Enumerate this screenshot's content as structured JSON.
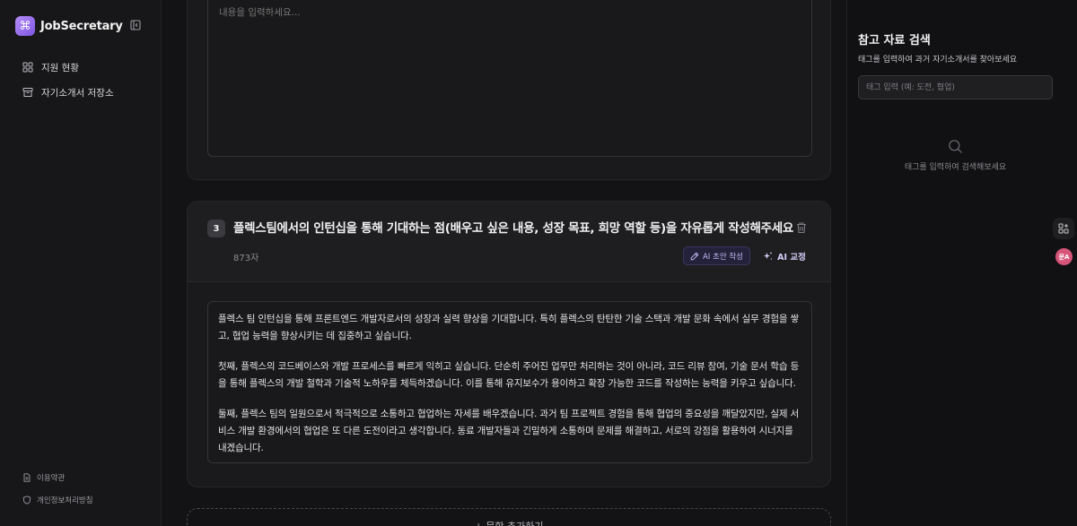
{
  "sidebar": {
    "logo_symbol": "⌘",
    "app_name": "JobSecretary",
    "nav": [
      {
        "label": "지원 현황",
        "icon": "grid-icon"
      },
      {
        "label": "자기소개서 저장소",
        "icon": "archive-icon"
      }
    ],
    "footer": [
      {
        "label": "이용약관",
        "icon": "document-icon"
      },
      {
        "label": "개인정보처리방침",
        "icon": "shield-icon"
      }
    ]
  },
  "editor": {
    "prev_placeholder": "내용을 입력하세요...",
    "question": {
      "number": "3",
      "title": "플렉스팀에서의 인턴십을 통해 기대하는 점(배우고 싶은 내용, 성장 목표, 희망 역할 등)을 자유롭게 작성해주세요",
      "char_count": "873자",
      "draft_label": "AI 초안 작성",
      "proof_label": "AI 교정",
      "answer": [
        "플렉스 팀 인턴십을 통해 프론트엔드 개발자로서의 성장과 실력 향상을 기대합니다. 특히 플렉스의 탄탄한 기술 스택과 개발 문화 속에서 실무 경험을 쌓고, 협업 능력을 향상시키는 데 집중하고 싶습니다.",
        "첫째, 플렉스의 코드베이스와 개발 프로세스를 빠르게 익히고 싶습니다. 단순히 주어진 업무만 처리하는 것이 아니라, 코드 리뷰 참여, 기술 문서 학습 등을 통해 플렉스의 개발 철학과 기술적 노하우를 체득하겠습니다. 이를 통해 유지보수가 용이하고 확장 가능한 코드를 작성하는 능력을 키우고 싶습니다.",
        "둘째, 플렉스 팀의 일원으로서 적극적으로 소통하고 협업하는 자세를 배우겠습니다. 과거 팀 프로젝트 경험을 통해 협업의 중요성을 깨달았지만, 실제 서비스 개발 환경에서의 협업은 또 다른 도전이라고 생각합니다. 동료 개발자들과 긴밀하게 소통하며 문제를 해결하고, 서로의 강점을 활용하여 시너지를 내겠습니다."
      ]
    },
    "add_label": "+ 문항 추가하기"
  },
  "reference": {
    "title": "참고 자료 검색",
    "subtitle": "태그를 입력하여 과거 자기소개서를 찾아보세요",
    "input_placeholder": "태그 입력 (예: 도전, 협업)",
    "empty_text": "태그를 입력하여 검색해보세요",
    "float_badge": "문A"
  },
  "colors": {
    "accent": "#7d56e6",
    "bg": "#131315",
    "card": "#1a1a1c"
  }
}
